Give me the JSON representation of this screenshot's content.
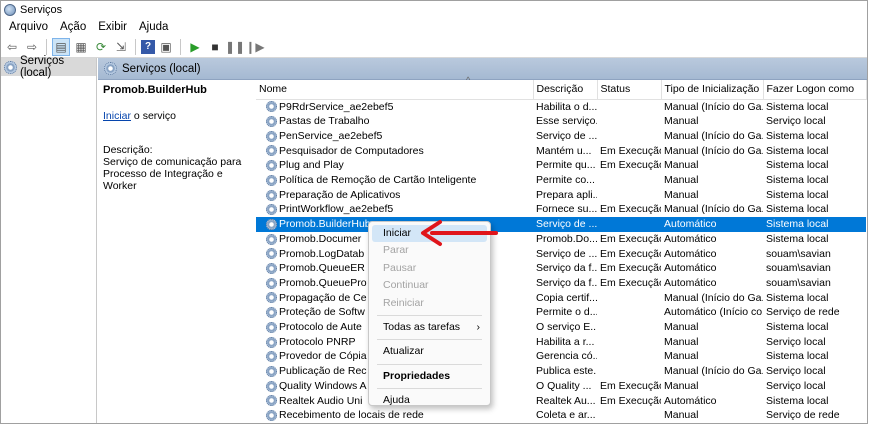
{
  "window": {
    "title": "Serviços"
  },
  "menu": [
    "Arquivo",
    "Ação",
    "Exibir",
    "Ajuda"
  ],
  "toolbar_icons": [
    "back-icon",
    "forward-icon",
    "console-tree-icon",
    "properties-icon",
    "refresh-icon",
    "export-icon",
    "help-icon",
    "view-icon",
    "play-icon",
    "stop-icon",
    "pause-icon",
    "restart-icon"
  ],
  "tree": {
    "root": "Serviços (local)"
  },
  "pane_header": "Serviços (local)",
  "description_panel": {
    "service_name": "Promob.BuilderHub",
    "start_link": "Iniciar",
    "start_suffix": " o serviço",
    "description_label": "Descrição:",
    "description_text": "Serviço de comunicação para Processo de Integração e Worker"
  },
  "columns": [
    "Nome",
    "Descrição",
    "Status",
    "Tipo de Inicialização",
    "Fazer Logon como"
  ],
  "rows": [
    [
      "P9RdrService_ae2ebef5",
      "Habilita o d...",
      "",
      "Manual (Início do Ga...",
      "Sistema local"
    ],
    [
      "Pastas de Trabalho",
      "Esse serviço...",
      "",
      "Manual",
      "Serviço local"
    ],
    [
      "PenService_ae2ebef5",
      "Serviço de ...",
      "",
      "Manual (Início do Ga...",
      "Sistema local"
    ],
    [
      "Pesquisador de Computadores",
      "Mantém u...",
      "Em Execução",
      "Manual (Início do Ga...",
      "Sistema local"
    ],
    [
      "Plug and Play",
      "Permite qu...",
      "Em Execução",
      "Manual",
      "Sistema local"
    ],
    [
      "Política de Remoção de Cartão Inteligente",
      "Permite co...",
      "",
      "Manual",
      "Sistema local"
    ],
    [
      "Preparação de Aplicativos",
      "Prepara apli...",
      "",
      "Manual",
      "Sistema local"
    ],
    [
      "PrintWorkflow_ae2ebef5",
      "Fornece su...",
      "Em Execução",
      "Manual (Início do Ga...",
      "Sistema local"
    ],
    [
      "Promob.BuilderHub",
      "Serviço de ...",
      "",
      "Automático",
      "Sistema local"
    ],
    [
      "Promob.Documer",
      "Promob.Do...",
      "Em Execução",
      "Automático",
      "Sistema local"
    ],
    [
      "Promob.LogDatab",
      "Serviço de ...",
      "Em Execução",
      "Automático",
      "souam\\savian"
    ],
    [
      "Promob.QueueER",
      "Serviço da f...",
      "Em Execução",
      "Automático",
      "souam\\savian"
    ],
    [
      "Promob.QueuePro",
      "Serviço da f...",
      "Em Execução",
      "Automático",
      "souam\\savian"
    ],
    [
      "Propagação de Ce",
      "Copia certif...",
      "",
      "Manual (Início do Ga...",
      "Sistema local"
    ],
    [
      "Proteção de Softw",
      "Permite o d...",
      "",
      "Automático (Início co...",
      "Serviço de rede"
    ],
    [
      "Protocolo de Aute",
      "O serviço E...",
      "",
      "Manual",
      "Sistema local"
    ],
    [
      "Protocolo PNRP",
      "Habilita a r...",
      "",
      "Manual",
      "Serviço local"
    ],
    [
      "Provedor de Cópia                    osoft",
      "Gerencia có...",
      "",
      "Manual",
      "Sistema local"
    ],
    [
      "Publicação de Rec",
      "Publica este...",
      "",
      "Manual (Início do Ga...",
      "Serviço local"
    ],
    [
      "Quality Windows A",
      "O Quality ...",
      "Em Execução",
      "Manual",
      "Serviço local"
    ],
    [
      "Realtek Audio Uni",
      "Realtek Au...",
      "Em Execução",
      "Automático",
      "Sistema local"
    ],
    [
      "Recebimento de locais de rede",
      "Coleta e ar...",
      "",
      "Manual",
      "Serviço de rede"
    ]
  ],
  "context_menu": {
    "iniciar": "Iniciar",
    "parar": "Parar",
    "pausar": "Pausar",
    "continuar": "Continuar",
    "reiniciar": "Reiniciar",
    "todas_tarefas": "Todas as tarefas",
    "atualizar": "Atualizar",
    "propriedades": "Propriedades",
    "ajuda": "Ajuda",
    "submenu_arrow": "›"
  },
  "colors": {
    "selection": "#0078d7",
    "annotation_arrow": "#e0151b",
    "header_band": "#b9c9dd"
  }
}
